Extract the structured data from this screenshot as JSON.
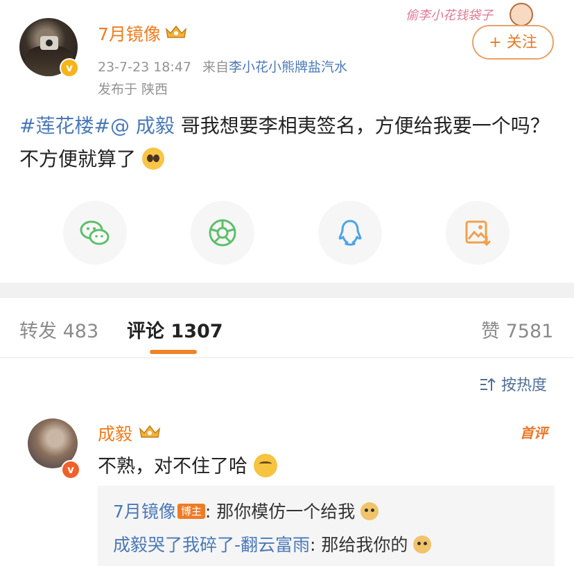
{
  "post": {
    "username": "7月镜像",
    "timestamp": "23-7-23 18:47",
    "source_prefix": "来自",
    "source": "李小花小熊牌盐汽水",
    "location": "发布于 陕西",
    "follow_label": "+ 关注",
    "sticker_text": "偷李小花钱袋子",
    "text_tag": "#莲花楼#",
    "text_mention": "@ 成毅",
    "text_body": " 哥我想要李相夷签名，方便给我要一个吗？不方便就算了"
  },
  "share": {
    "icons": [
      "wechat-icon",
      "moments-icon",
      "qq-icon",
      "save-image-icon"
    ]
  },
  "tabs": {
    "repost_label": "转发",
    "repost_count": "483",
    "comment_label": "评论",
    "comment_count": "1307",
    "like_label": "赞",
    "like_count": "7581"
  },
  "sort": {
    "label": "按热度"
  },
  "comment": {
    "username": "成毅",
    "badge": "首评",
    "text": "不熟，对不住了哈",
    "replies": [
      {
        "name": "7月镜像",
        "tag": "博主",
        "text": ": 那你模仿一个给我"
      },
      {
        "name": "成毅哭了我碎了-翻云富雨",
        "tag": "",
        "text": ": 那给我你的"
      }
    ]
  },
  "colors": {
    "accent_orange": "#f07c1f",
    "link_blue": "#4a78b8"
  }
}
